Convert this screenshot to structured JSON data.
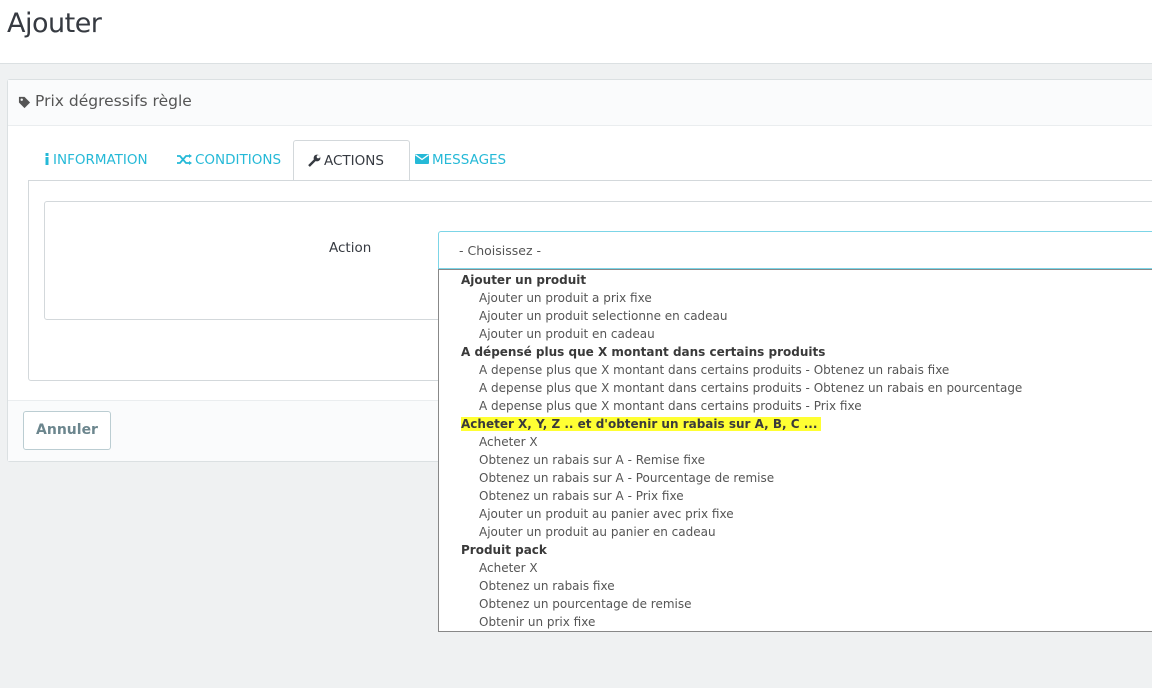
{
  "page": {
    "title": "Ajouter"
  },
  "panel": {
    "heading": "Prix dégressifs règle"
  },
  "tabs": [
    {
      "label": "INFORMATION",
      "icon": "info-icon"
    },
    {
      "label": "CONDITIONS",
      "icon": "shuffle-icon"
    },
    {
      "label": "ACTIONS",
      "icon": "wrench-icon",
      "active": true
    },
    {
      "label": "MESSAGES",
      "icon": "envelope-icon"
    }
  ],
  "form": {
    "action_label": "Action",
    "select_value": "- Choisissez -"
  },
  "footer": {
    "cancel_label": "Annuler"
  },
  "dropdown": {
    "groups": [
      {
        "label": "Ajouter un produit",
        "options": [
          "Ajouter un produit a prix fixe",
          "Ajouter un produit selectionne en cadeau",
          "Ajouter un produit en cadeau"
        ]
      },
      {
        "label": "A dépensé plus que X montant dans certains produits",
        "options": [
          "A depense plus que X montant dans certains produits - Obtenez un rabais fixe",
          "A depense plus que X montant dans certains produits - Obtenez un rabais en pourcentage",
          "A depense plus que X montant dans certains produits - Prix fixe"
        ]
      },
      {
        "label": "Acheter X, Y, Z .. et d'obtenir un rabais sur A, B, C ...",
        "highlighted": true,
        "options": [
          "Acheter X",
          "Obtenez un rabais sur A - Remise fixe",
          "Obtenez un rabais sur A - Pourcentage de remise",
          "Obtenez un rabais sur A - Prix fixe",
          "Ajouter un produit au panier avec prix fixe",
          "Ajouter un produit au panier en cadeau"
        ]
      },
      {
        "label": "Produit pack",
        "options": [
          "Acheter X",
          "Obtenez un rabais fixe",
          "Obtenez un pourcentage de remise",
          "Obtenir un prix fixe"
        ]
      }
    ]
  },
  "colors": {
    "accent": "#25b9d7",
    "highlight": "#ffff33",
    "page_bg": "#eff1f2"
  }
}
